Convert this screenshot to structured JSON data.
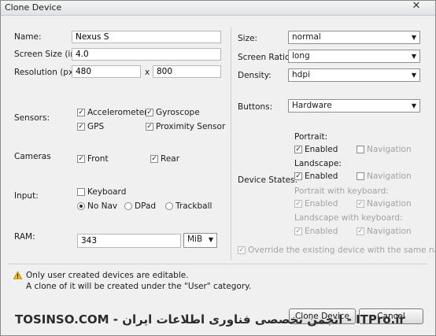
{
  "window": {
    "title": "Clone Device",
    "close_glyph": "✕"
  },
  "left": {
    "name_label": "Name:",
    "name_value": "Nexus S",
    "screen_size_label": "Screen Size (in):",
    "screen_size_value": "4.0",
    "resolution_label": "Resolution (px):",
    "res_w": "480",
    "res_x": "x",
    "res_h": "800",
    "sensors_label": "Sensors:",
    "accelerometer": "Accelerometer",
    "gyroscope": "Gyroscope",
    "gps": "GPS",
    "proximity": "Proximity Sensor",
    "cameras_label": "Cameras",
    "front": "Front",
    "rear": "Rear",
    "input_label": "Input:",
    "keyboard": "Keyboard",
    "nonav": "No Nav",
    "dpad": "DPad",
    "trackball": "Trackball",
    "ram_label": "RAM:",
    "ram_value": "343",
    "ram_unit": "MiB"
  },
  "right": {
    "size_label": "Size:",
    "size_value": "normal",
    "ratio_label": "Screen Ratio:",
    "ratio_value": "long",
    "density_label": "Density:",
    "density_value": "hdpi",
    "buttons_label": "Buttons:",
    "buttons_value": "Hardware",
    "states_label": "Device States:",
    "portrait": "Portrait:",
    "landscape": "Landscape:",
    "portrait_kb": "Portrait with keyboard:",
    "landscape_kb": "Landscape with keyboard:",
    "enabled": "Enabled",
    "navigation": "Navigation",
    "override": "Override the existing device with the same name"
  },
  "footer": {
    "warn_line1": "Only user created devices are editable.",
    "warn_line2": "A clone of it will be created under the \"User\" category.",
    "clone_button": "Clone Device",
    "cancel_button": "Cancel",
    "watermark": "TOSINSO.COM - انجمن تخصصی فناوری اطلاعات ایران - ITPro.ir"
  },
  "glyphs": {
    "check": "✓",
    "dropdown": "▼"
  }
}
